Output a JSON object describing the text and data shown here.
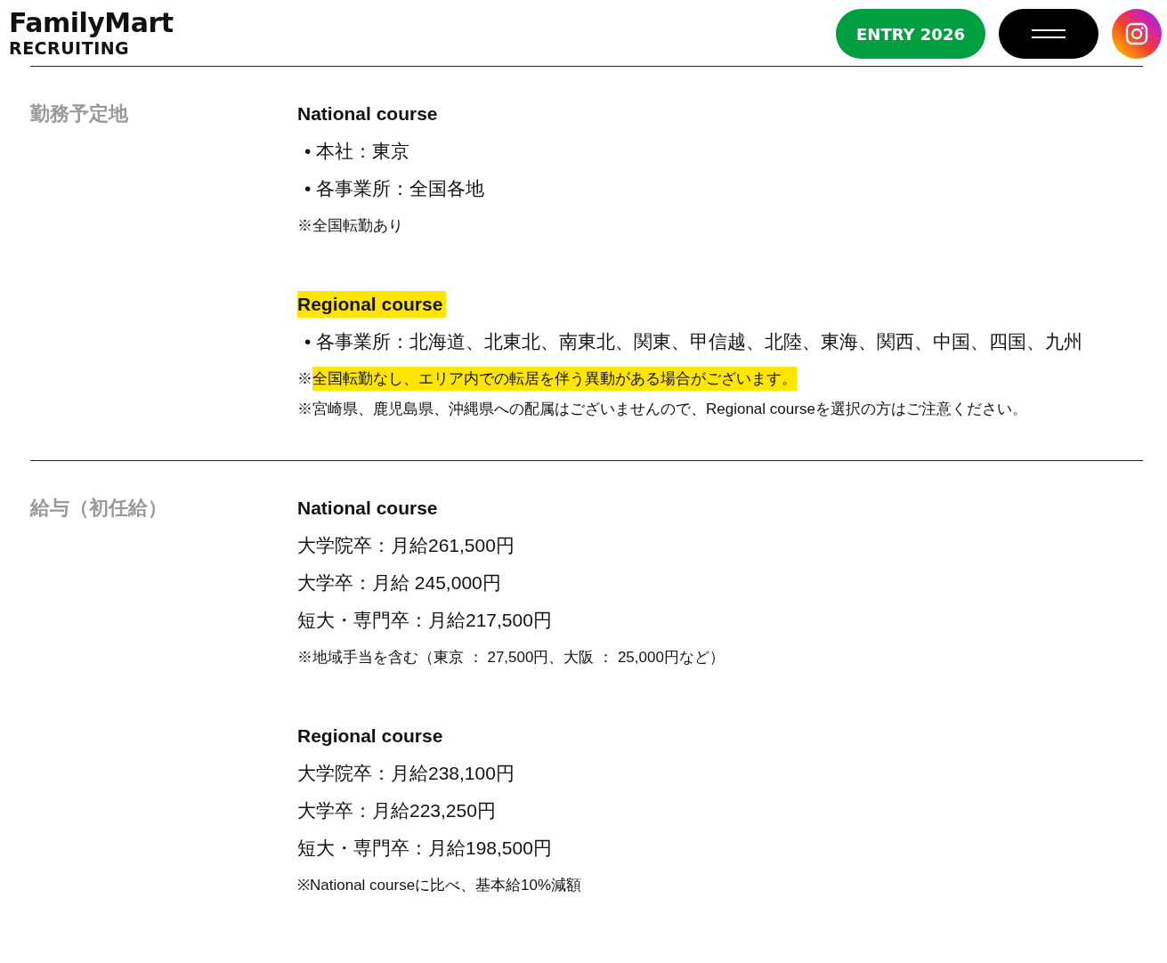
{
  "header": {
    "logo": "FamilyMart",
    "logo_sub": "RECRUITING",
    "entry_button": "ENTRY 2026"
  },
  "sections": [
    {
      "label": "勤務予定地",
      "blocks": [
        {
          "heading": "National course",
          "highlighted": false,
          "items": [
            {
              "kind": "bullet",
              "mark": "•",
              "text": "本社：東京"
            },
            {
              "kind": "bullet",
              "mark": "•",
              "text": "各事業所：全国各地"
            },
            {
              "kind": "note",
              "mark": "※",
              "text": "全国転勤あり",
              "highlighted": false
            }
          ]
        },
        {
          "heading": "Regional course",
          "highlighted": true,
          "items": [
            {
              "kind": "bullet",
              "mark": "•",
              "text": "各事業所：北海道、北東北、南東北、関東、甲信越、北陸、東海、関西、中国、四国、九州"
            },
            {
              "kind": "note",
              "mark": "※",
              "text": "全国転勤なし、エリア内での転居を伴う異動がある場合がございます。",
              "highlighted": true
            },
            {
              "kind": "note",
              "mark": "※",
              "text": "宮崎県、鹿児島県、沖縄県への配属はございませんので、Regional courseを選択の方はご注意ください。",
              "highlighted": false
            }
          ]
        }
      ]
    },
    {
      "label": "給与（初任給）",
      "blocks": [
        {
          "heading": "National course",
          "highlighted": false,
          "items": [
            {
              "kind": "line",
              "text": "大学院卒：月給261,500円"
            },
            {
              "kind": "line",
              "text": "大学卒：月給 245,000円"
            },
            {
              "kind": "line",
              "text": "短大・専門卒：月給217,500円"
            },
            {
              "kind": "note",
              "mark": "※",
              "text": "地域手当を含む（東京 ： 27,500円、大阪 ： 25,000円など）",
              "highlighted": false
            }
          ]
        },
        {
          "heading": "Regional course",
          "highlighted": false,
          "items": [
            {
              "kind": "line",
              "text": "大学院卒：月給238,100円"
            },
            {
              "kind": "line",
              "text": "大学卒：月給223,250円"
            },
            {
              "kind": "line",
              "text": "短大・専門卒：月給198,500円"
            },
            {
              "kind": "note",
              "mark": "※",
              "text": "National courseに比べ、基本給10%減額",
              "highlighted": false
            }
          ]
        }
      ]
    }
  ]
}
